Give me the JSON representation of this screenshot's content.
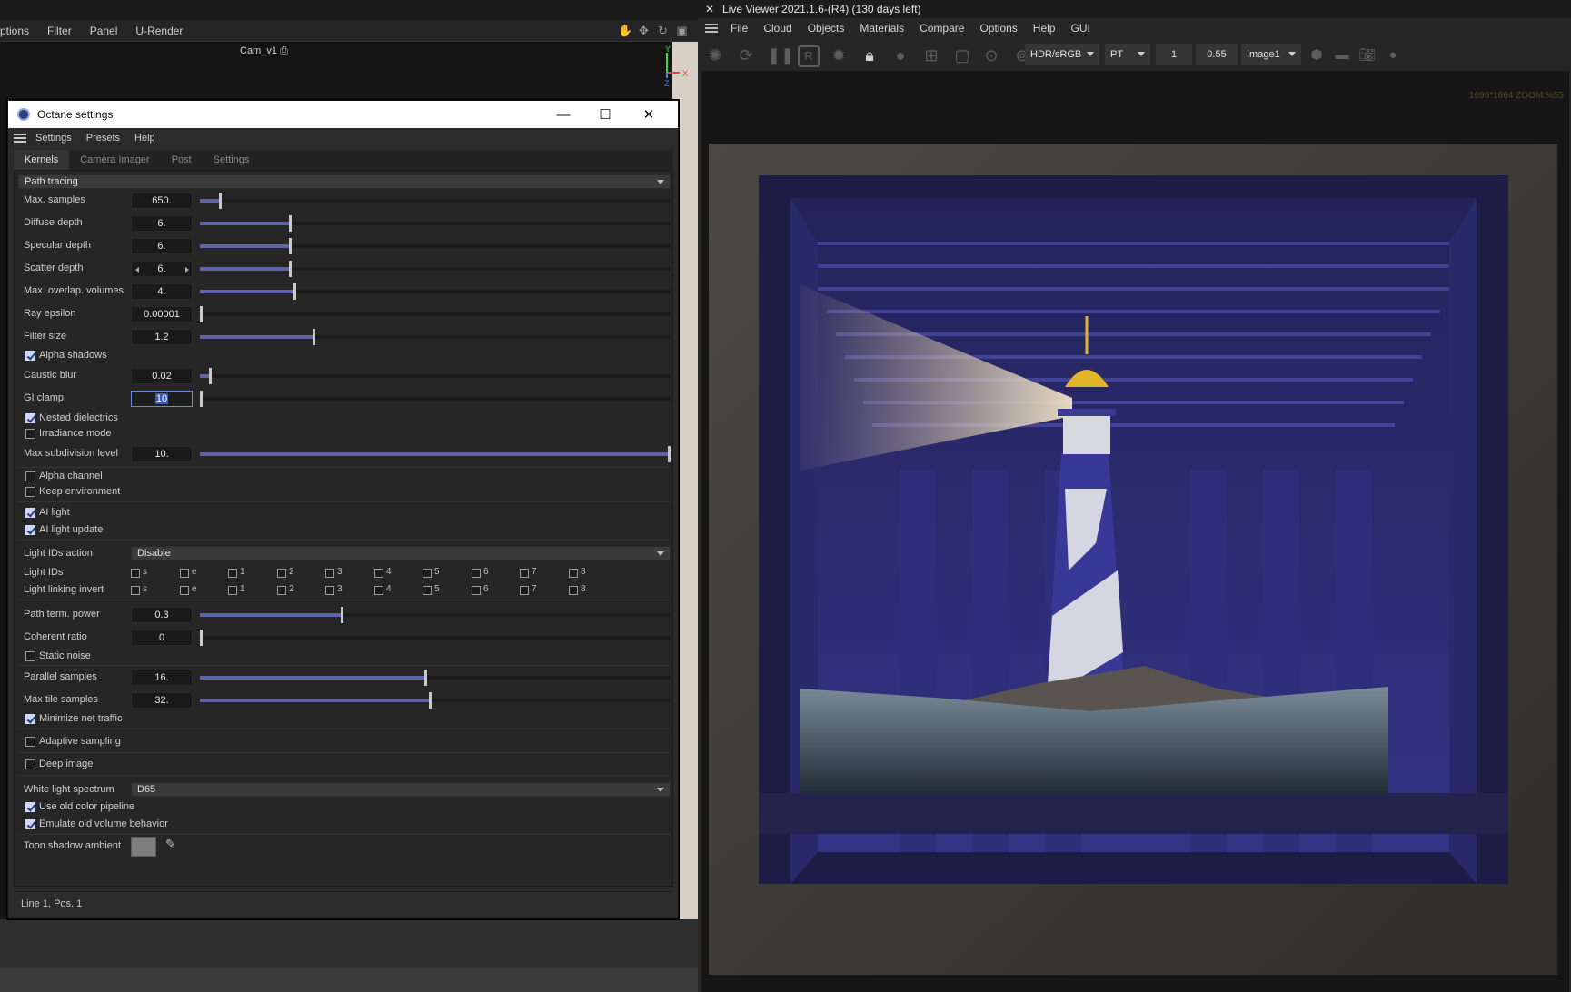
{
  "host": {
    "menu": [
      "ptions",
      "Filter",
      "Panel",
      "U-Render"
    ],
    "camera_label": "Cam_v1",
    "axis": {
      "y": "Y",
      "x": "X",
      "z": "Z"
    }
  },
  "dialog": {
    "title": "Octane settings",
    "menu": [
      "Settings",
      "Presets",
      "Help"
    ],
    "tabs": [
      "Kernels",
      "Camera Imager",
      "Post",
      "Settings"
    ],
    "active_tab": "Kernels",
    "kernel": "Path tracing",
    "fields": {
      "max_samples": {
        "label": "Max. samples",
        "value": "650.",
        "fraction": 0.04
      },
      "diffuse_depth": {
        "label": "Diffuse depth",
        "value": "6.",
        "fraction": 0.19
      },
      "specular_depth": {
        "label": "Specular depth",
        "value": "6.",
        "fraction": 0.19
      },
      "scatter_depth": {
        "label": "Scatter depth",
        "value": "6.",
        "fraction": 0.19
      },
      "max_overlap": {
        "label": "Max. overlap. volumes",
        "value": "4.",
        "fraction": 0.2
      },
      "ray_epsilon": {
        "label": "Ray epsilon",
        "value": "0.00001",
        "fraction": 0.0
      },
      "filter_size": {
        "label": "Filter size",
        "value": "1.2",
        "fraction": 0.24
      },
      "caustic_blur": {
        "label": "Caustic blur",
        "value": "0.02",
        "fraction": 0.02
      },
      "gi_clamp": {
        "label": "GI clamp",
        "value": "10",
        "fraction": 0.0
      },
      "max_subdiv": {
        "label": "Max subdivision level",
        "value": "10.",
        "fraction": 1.0
      },
      "path_term": {
        "label": "Path term. power",
        "value": "0.3",
        "fraction": 0.3
      },
      "coherent": {
        "label": "Coherent ratio",
        "value": "0",
        "fraction": 0.0
      },
      "parallel": {
        "label": "Parallel samples",
        "value": "16.",
        "fraction": 0.48
      },
      "max_tile": {
        "label": "Max tile samples",
        "value": "32.",
        "fraction": 0.49
      }
    },
    "checks": {
      "alpha_shadows": {
        "label": "Alpha shadows",
        "checked": true
      },
      "nested_dielectrics": {
        "label": "Nested dielectrics",
        "checked": true
      },
      "irradiance_mode": {
        "label": "Irradiance mode",
        "checked": false
      },
      "alpha_channel": {
        "label": "Alpha channel",
        "checked": false
      },
      "keep_environment": {
        "label": "Keep environment",
        "checked": false
      },
      "ai_light": {
        "label": "AI light",
        "checked": true
      },
      "ai_light_update": {
        "label": "AI light update",
        "checked": true
      },
      "static_noise": {
        "label": "Static noise",
        "checked": false
      },
      "minimize_net": {
        "label": "Minimize net traffic",
        "checked": true
      },
      "adaptive": {
        "label": "Adaptive sampling",
        "checked": false
      },
      "deep_image": {
        "label": "Deep image",
        "checked": false
      },
      "old_color": {
        "label": "Use old color pipeline",
        "checked": true
      },
      "old_volume": {
        "label": "Emulate old volume behavior",
        "checked": true
      }
    },
    "light_ids_action": {
      "label": "Light IDs action",
      "value": "Disable"
    },
    "light_ids": {
      "label": "Light IDs",
      "items": [
        "s",
        "e",
        "1",
        "2",
        "3",
        "4",
        "5",
        "6",
        "7",
        "8"
      ]
    },
    "light_linking": {
      "label": "Light linking invert",
      "items": [
        "s",
        "e",
        "1",
        "2",
        "3",
        "4",
        "5",
        "6",
        "7",
        "8"
      ]
    },
    "white_light": {
      "label": "White light spectrum",
      "value": "D65"
    },
    "toon_shadow": {
      "label": "Toon shadow ambient",
      "color": "#7e7e7e"
    },
    "status": "Line 1, Pos. 1"
  },
  "viewer": {
    "title": "Live Viewer 2021.1.6-(R4) (130 days left)",
    "menu": [
      "File",
      "Cloud",
      "Objects",
      "Materials",
      "Compare",
      "Options",
      "Help",
      "GUI"
    ],
    "color_mode": "HDR/sRGB",
    "kernel_mode": "PT",
    "value_a": "1",
    "value_b": "0.55",
    "image": "Image1",
    "info": "1696*1664 ZOOM:%55"
  },
  "colors": {
    "accent": "#5e64a8",
    "dialog_bg": "#2b2b2b",
    "container": "#2c2c6e"
  }
}
